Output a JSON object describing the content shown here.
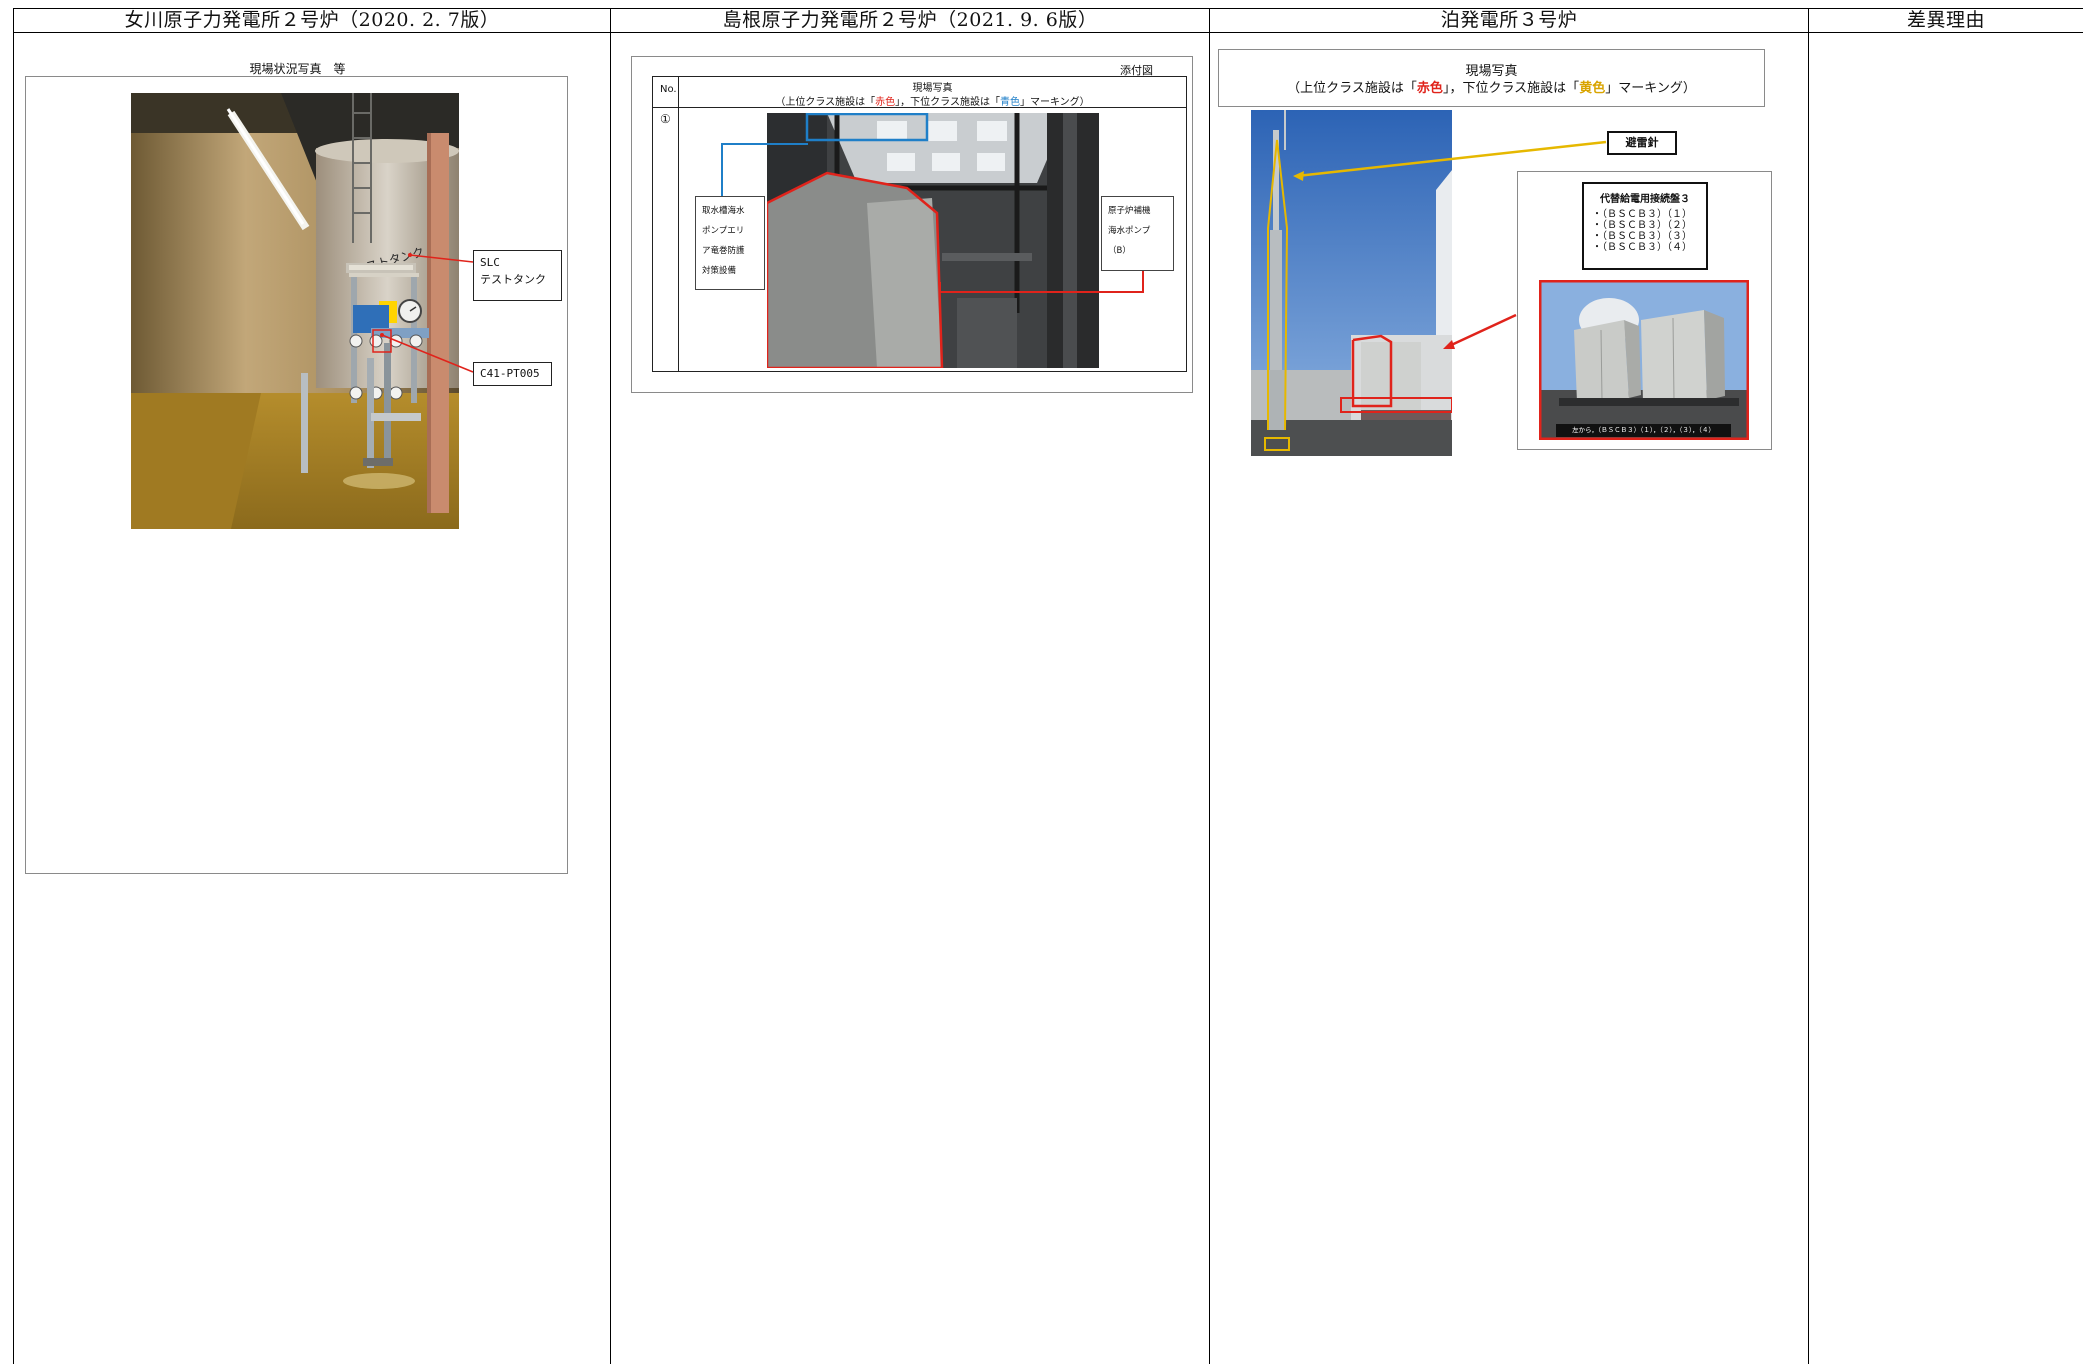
{
  "header": {
    "col1": "女川原子力発電所２号炉（2020. 2. 7版）",
    "col2": "島根原子力発電所２号炉（2021. 9. 6版）",
    "col3": "泊発電所３号炉",
    "col4": "差異理由"
  },
  "onagawa": {
    "caption": "現場状況写真　等",
    "label_slc_line1": "SLC",
    "label_slc_line2": "テストタンク",
    "label_pt": "C41-PT005",
    "tank_text": "ストタンク"
  },
  "shimane": {
    "attachment": "添付図",
    "no_header": "No.",
    "row_number": "①",
    "title_line1": "現場写真",
    "title_pre": "（上位クラス施設は「",
    "title_red": "赤色",
    "title_mid": "」，下位クラス施設は「",
    "title_blue": "青色",
    "title_post": "」マーキング）",
    "left_box": [
      "取水槽海水",
      "ポンプエリ",
      "ア竜巻防護",
      "対策設備"
    ],
    "right_box": [
      "原子炉補機",
      "海水ポンプ",
      "（B）"
    ]
  },
  "tomari": {
    "title_line1": "現場写真",
    "title_pre": "（上位クラス施設は「",
    "title_red": "赤色",
    "title_mid": "」，下位クラス施設は「",
    "title_yellow": "黄色",
    "title_post": "」マーキング）",
    "lightning_label": "避雷針",
    "panel_title": "代替給電用接続盤３",
    "panel_items": [
      "・（ＢＳＣＢ３）（１）",
      "・（ＢＳＣＢ３）（２）",
      "・（ＢＳＣＢ３）（３）",
      "・（ＢＳＣＢ３）（４）"
    ],
    "inset_caption": "左から，（ＢＳＣＢ３）（１），（２），（３），（４）"
  },
  "colors": {
    "marking_red": "#e0231b",
    "marking_blue": "#1f7fc8",
    "marking_yellow": "#e6b800"
  }
}
